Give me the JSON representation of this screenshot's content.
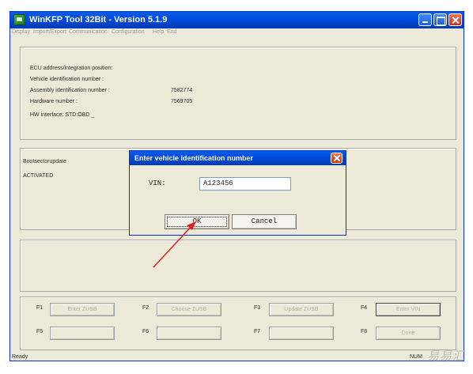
{
  "window": {
    "title": "WinKFP Tool 32Bit - Version 5.1.9"
  },
  "menu": [
    "Display",
    "Import/Export",
    "Communication",
    "Configuration",
    "Help",
    "End"
  ],
  "info": {
    "rows": [
      {
        "label": "ECU address/integration position:",
        "value": ""
      },
      {
        "label": "Vehicle identification number :",
        "value": ""
      },
      {
        "label": "Assembly identification number :",
        "value": "7582774"
      },
      {
        "label": "Hardware number :",
        "value": "7569705"
      }
    ],
    "hw_interface": "HW interface:  STD:OBD _"
  },
  "boot": {
    "label": "Bootsectorupdate",
    "status": "ACTIVATED"
  },
  "fkeys": {
    "row1": [
      {
        "key": "F1",
        "label": "Enter ZUSB",
        "enabled": false
      },
      {
        "key": "F2",
        "label": "Choose ZUSB",
        "enabled": false
      },
      {
        "key": "F3",
        "label": "Update ZUSB",
        "enabled": false
      },
      {
        "key": "F4",
        "label": "Enter VIN",
        "enabled": true
      }
    ],
    "row2": [
      {
        "key": "F5",
        "label": "",
        "enabled": false
      },
      {
        "key": "F6",
        "label": "",
        "enabled": false
      },
      {
        "key": "F7",
        "label": "",
        "enabled": false
      },
      {
        "key": "F8",
        "label": "Done",
        "enabled": false
      }
    ]
  },
  "status": {
    "text": "Ready",
    "right": "NUM"
  },
  "dialog": {
    "title": "Enter vehicle identification number",
    "vin_label": "VIN:",
    "vin_value": "A123456",
    "ok_label": "OK",
    "cancel_label": "Cancel"
  },
  "annotation": {
    "arrow_color": "#e02020"
  },
  "watermark": "易易汇"
}
